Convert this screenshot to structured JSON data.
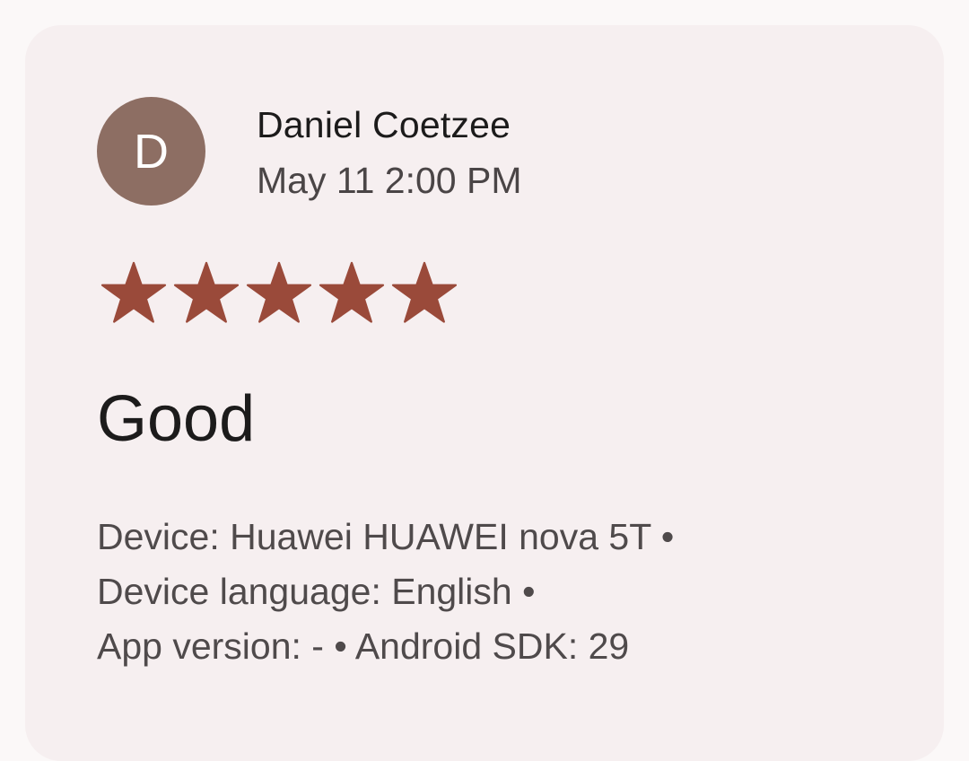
{
  "review": {
    "avatar_letter": "D",
    "author": "Daniel Coetzee",
    "date": "May 11 2:00 PM",
    "rating": 5,
    "rating_max": 5,
    "title": "Good",
    "meta_lines": [
      "Device: Huawei HUAWEI nova 5T •",
      "Device language: English •",
      "App version: - • Android SDK: 29"
    ]
  },
  "colors": {
    "star": "#9a4a3a",
    "avatar": "#8d6e63",
    "card": "#f6eff0"
  }
}
